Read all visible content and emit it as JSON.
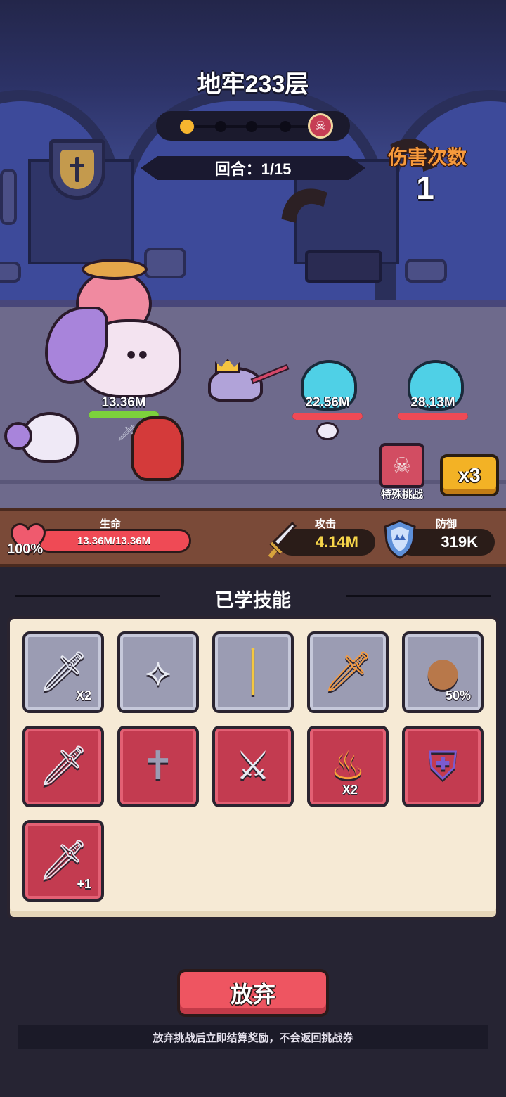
{
  "header": {
    "title": "地牢233层",
    "round_text": "回合：1/15",
    "boss_icon": "skull-icon"
  },
  "battle": {
    "hits_label": "伤害次数",
    "hits_value": "1",
    "player_hp": "13.36M",
    "player_hp_fraction": 1.0,
    "enemies": [
      {
        "hp": "22.56M",
        "hp_fraction": 1.0
      },
      {
        "hp": "28.13M",
        "hp_fraction": 1.0
      }
    ],
    "special_challenge_label": "特殊挑战",
    "speed_label": "x3"
  },
  "stats": {
    "life_caption": "生命",
    "life_value": "13.36M/13.36M",
    "life_percent": "100%",
    "attack_caption": "攻击",
    "attack_value": "4.14M",
    "defense_caption": "防御",
    "defense_value": "319K",
    "colors": {
      "attack": "#f6d54a",
      "defense": "#ffffff",
      "life": "#ef4a55"
    }
  },
  "skills": {
    "title": "已学技能",
    "items": [
      {
        "icon": "double-sword-icon",
        "style": "gray",
        "glyph": "🗡",
        "badge": "X2"
      },
      {
        "icon": "kunai-icon",
        "style": "gray",
        "glyph": "⟡",
        "badge": ""
      },
      {
        "icon": "golden-blade-icon",
        "style": "gray",
        "glyph": "│",
        "badge": ""
      },
      {
        "icon": "flaming-sword-icon",
        "style": "gray",
        "glyph": "🗡",
        "badge": ""
      },
      {
        "icon": "capybara-icon",
        "style": "gray",
        "glyph": "●",
        "badge": "50%"
      },
      {
        "icon": "sword-upgrade-icon",
        "style": "red",
        "glyph": "🗡",
        "badge": ""
      },
      {
        "icon": "tombstone-icon",
        "style": "red",
        "glyph": "✝",
        "badge": ""
      },
      {
        "icon": "sword-strike-icon",
        "style": "red",
        "glyph": "⚔",
        "badge": ""
      },
      {
        "icon": "fire-icon",
        "style": "red",
        "glyph": "♨",
        "badge": "X2"
      },
      {
        "icon": "shield-upgrade-icon",
        "style": "red",
        "glyph": "⛨",
        "badge": ""
      },
      {
        "icon": "sword-extra-icon",
        "style": "red",
        "glyph": "🗡",
        "badge": "+1"
      }
    ]
  },
  "footer": {
    "give_up_label": "放弃",
    "notice": "放弃挑战后立即结算奖励，不会返回挑战券"
  }
}
